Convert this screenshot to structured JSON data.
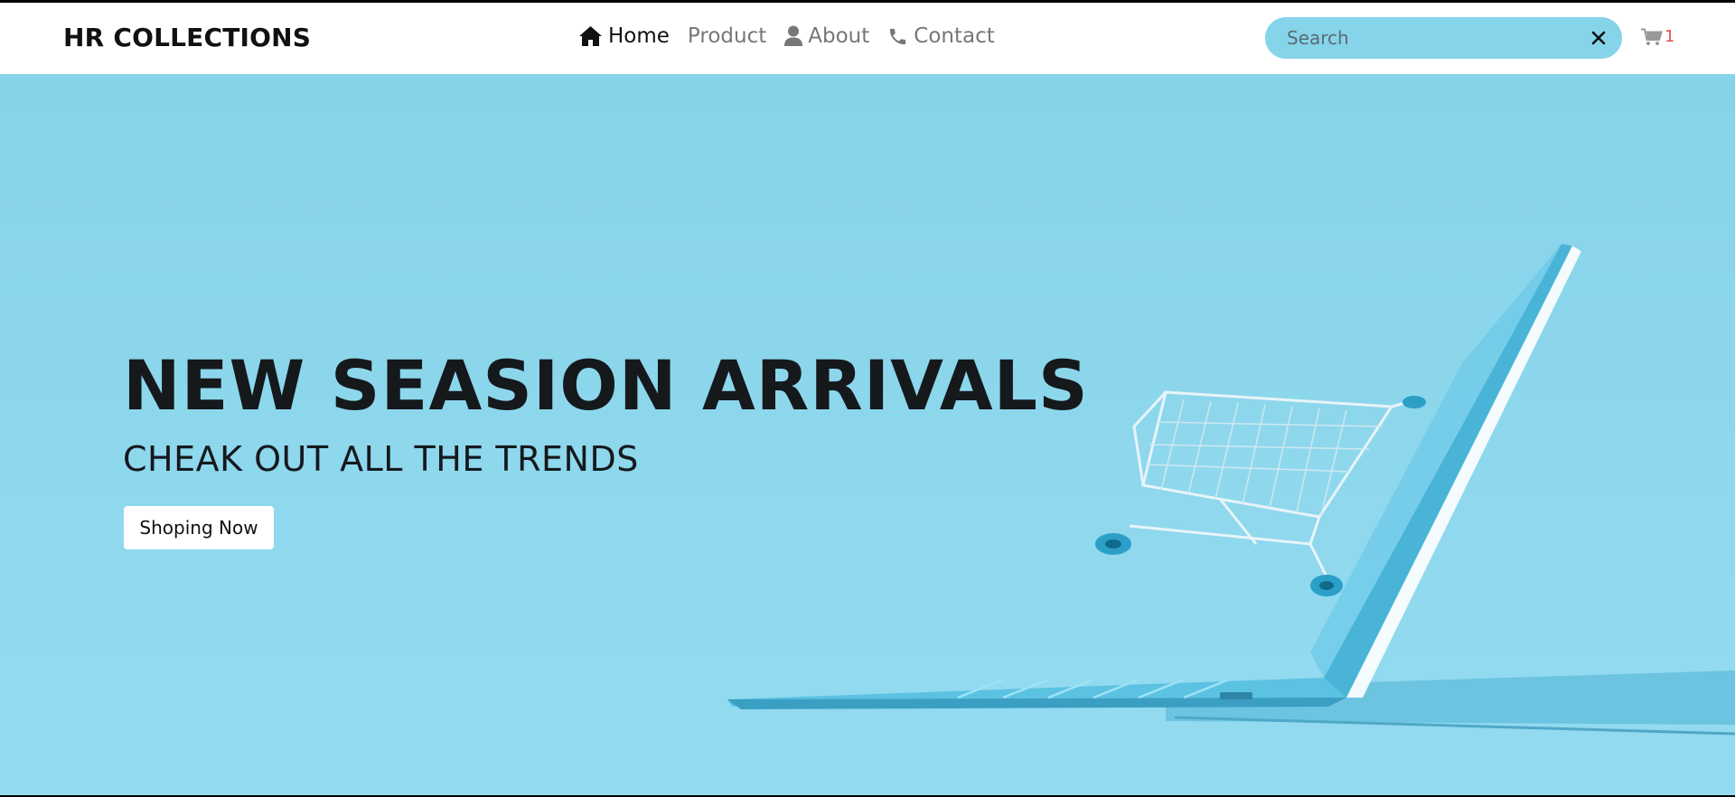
{
  "brand": "HR COLLECTIONS",
  "nav": {
    "home": "Home",
    "product": "Product",
    "about": "About",
    "contact": "Contact"
  },
  "icons": {
    "home": "home-icon",
    "about": "user-icon",
    "contact": "phone-icon",
    "clear": "close-icon",
    "cart": "cart-icon"
  },
  "search": {
    "placeholder": "Search",
    "value": ""
  },
  "cart": {
    "count": "1"
  },
  "hero": {
    "title": "NEW SEASION ARRIVALS",
    "subtitle": "CHEAK OUT ALL THE TRENDS",
    "button": "Shoping Now"
  },
  "colors": {
    "hero_bg": "#86d3e9",
    "search_bg": "#86d4ea",
    "cart_count": "#e05050"
  }
}
